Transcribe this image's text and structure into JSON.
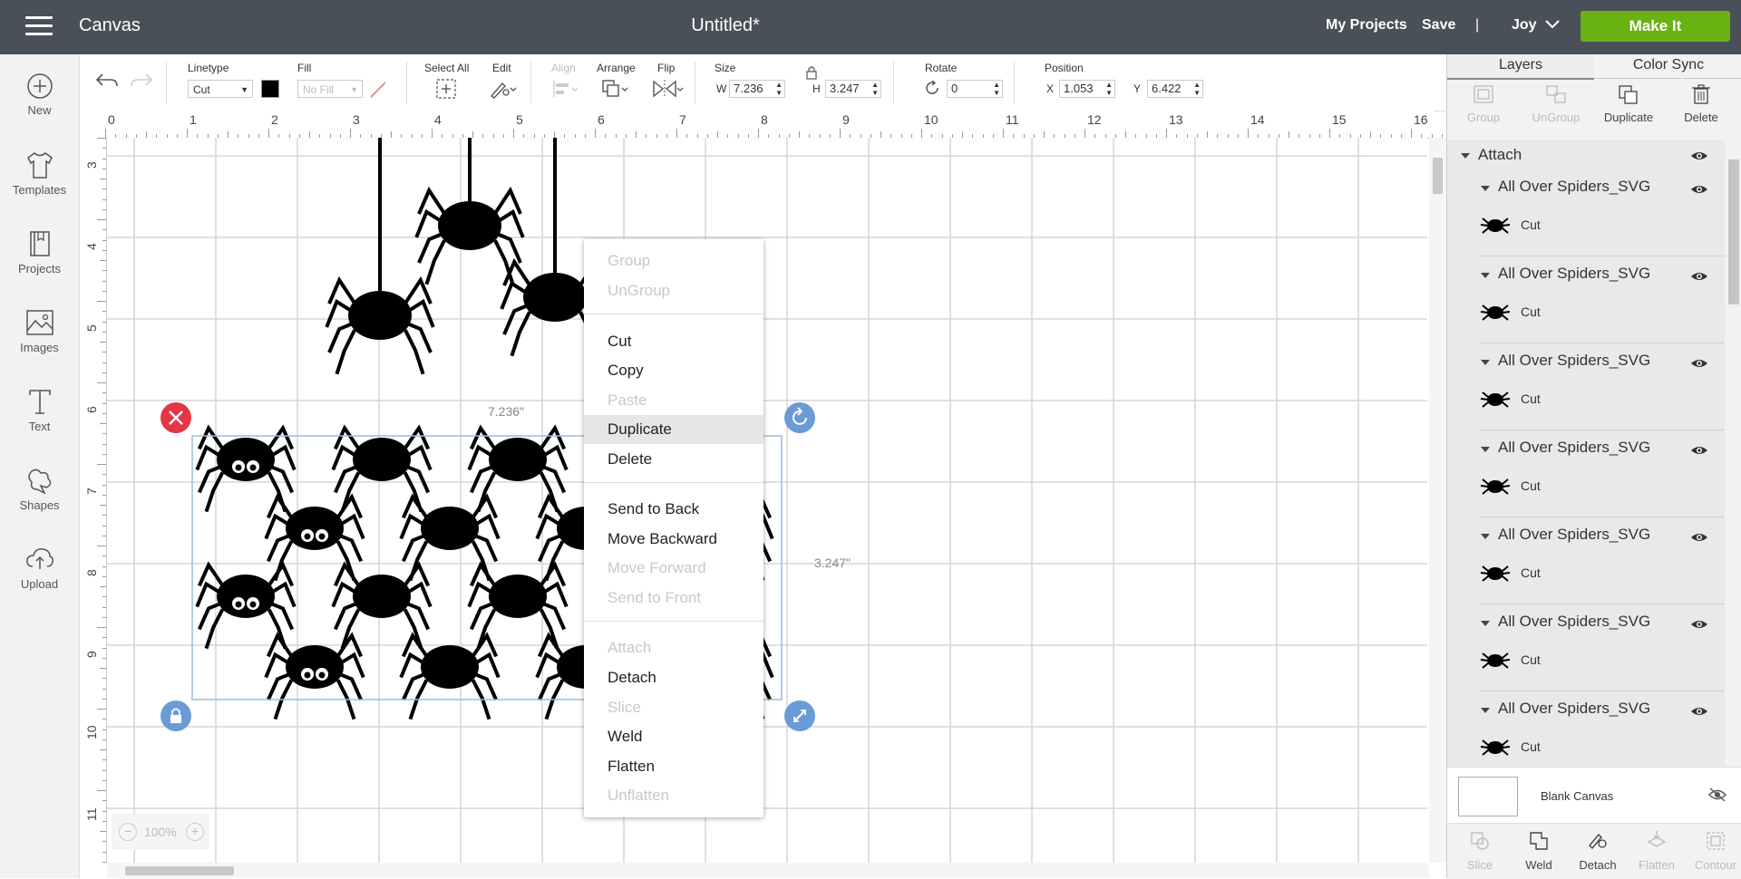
{
  "topbar": {
    "app_title": "Canvas",
    "doc_title": "Untitled*",
    "my_projects": "My Projects",
    "save": "Save",
    "divider": "|",
    "user": "Joy",
    "make_it": "Make It"
  },
  "leftrail": {
    "items": [
      {
        "label": "New",
        "icon": "plus-circle-icon"
      },
      {
        "label": "Templates",
        "icon": "tshirt-icon"
      },
      {
        "label": "Projects",
        "icon": "book-icon"
      },
      {
        "label": "Images",
        "icon": "image-icon"
      },
      {
        "label": "Text",
        "icon": "text-icon"
      },
      {
        "label": "Shapes",
        "icon": "shapes-icon"
      },
      {
        "label": "Upload",
        "icon": "cloud-upload-icon"
      }
    ]
  },
  "toolbar": {
    "linetype_label": "Linetype",
    "linetype_value": "Cut",
    "fill_label": "Fill",
    "fill_value": "No Fill",
    "select_all_label": "Select All",
    "edit_label": "Edit",
    "align_label": "Align",
    "arrange_label": "Arrange",
    "flip_label": "Flip",
    "size_label": "Size",
    "w_label": "W",
    "w_value": "7.236",
    "h_label": "H",
    "h_value": "3.247",
    "rotate_label": "Rotate",
    "rotate_value": "0",
    "position_label": "Position",
    "x_label": "X",
    "x_value": "1.053",
    "y_label": "Y",
    "y_value": "6.422"
  },
  "ruler": {
    "top": [
      "0",
      "1",
      "2",
      "3",
      "4",
      "5",
      "6",
      "7",
      "8",
      "9",
      "10",
      "11",
      "12",
      "13",
      "14",
      "15",
      "16"
    ],
    "left": [
      "3",
      "4",
      "5",
      "6",
      "7",
      "8",
      "9",
      "10",
      "11"
    ]
  },
  "selection": {
    "width_label": "7.236\"",
    "height_label": "3.247\""
  },
  "zoom": {
    "value": "100%",
    "minus": "−",
    "plus": "+"
  },
  "context_menu": {
    "items": [
      {
        "label": "Group",
        "enabled": false
      },
      {
        "label": "UnGroup",
        "enabled": false
      },
      {
        "label": "Cut",
        "enabled": true
      },
      {
        "label": "Copy",
        "enabled": true
      },
      {
        "label": "Paste",
        "enabled": false
      },
      {
        "label": "Duplicate",
        "enabled": true,
        "highlighted": true
      },
      {
        "label": "Delete",
        "enabled": true
      },
      {
        "label": "Send to Back",
        "enabled": true
      },
      {
        "label": "Move Backward",
        "enabled": true
      },
      {
        "label": "Move Forward",
        "enabled": false
      },
      {
        "label": "Send to Front",
        "enabled": false
      },
      {
        "label": "Attach",
        "enabled": false
      },
      {
        "label": "Detach",
        "enabled": true
      },
      {
        "label": "Slice",
        "enabled": false
      },
      {
        "label": "Weld",
        "enabled": true
      },
      {
        "label": "Flatten",
        "enabled": true
      },
      {
        "label": "Unflatten",
        "enabled": false
      }
    ]
  },
  "rightpanel": {
    "tabs": [
      "Layers",
      "Color Sync"
    ],
    "actions": [
      {
        "label": "Group",
        "enabled": false
      },
      {
        "label": "UnGroup",
        "enabled": false
      },
      {
        "label": "Duplicate",
        "enabled": true
      },
      {
        "label": "Delete",
        "enabled": true
      }
    ],
    "attach_group": "Attach",
    "layers": [
      {
        "name": "All Over Spiders_SVG",
        "sub": "Cut"
      },
      {
        "name": "All Over Spiders_SVG",
        "sub": "Cut"
      },
      {
        "name": "All Over Spiders_SVG",
        "sub": "Cut"
      },
      {
        "name": "All Over Spiders_SVG",
        "sub": "Cut"
      },
      {
        "name": "All Over Spiders_SVG",
        "sub": "Cut"
      },
      {
        "name": "All Over Spiders_SVG",
        "sub": "Cut"
      },
      {
        "name": "All Over Spiders_SVG",
        "sub": "Cut"
      }
    ],
    "blank_canvas": "Blank Canvas",
    "bottom_actions": [
      {
        "label": "Slice",
        "enabled": false
      },
      {
        "label": "Weld",
        "enabled": true
      },
      {
        "label": "Detach",
        "enabled": true
      },
      {
        "label": "Flatten",
        "enabled": false
      },
      {
        "label": "Contour",
        "enabled": false
      }
    ]
  },
  "colors": {
    "topbar": "#495057",
    "make_it": "#6ab214",
    "selection": "#9bbbe0",
    "delete_handle": "#e23744",
    "handle_blue": "#6a9bd6"
  }
}
